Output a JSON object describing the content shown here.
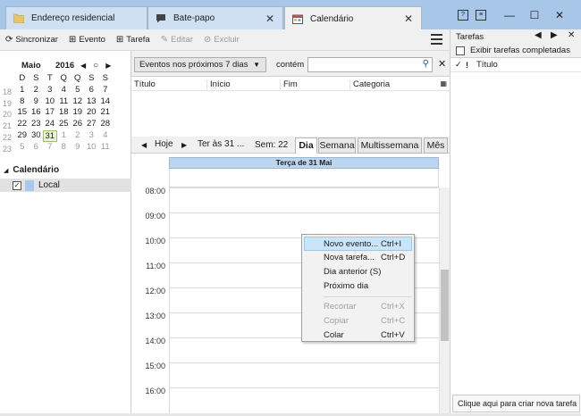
{
  "tabs": [
    {
      "label": "Endereço residencial",
      "icon": "folder-icon"
    },
    {
      "label": "Bate-papo",
      "icon": "chat-icon"
    },
    {
      "label": "Calendário",
      "icon": "calendar-icon"
    }
  ],
  "window": {
    "minimize": "—",
    "maximize": "☐",
    "close": "✕"
  },
  "toolbar": {
    "sync": "Sincronizar",
    "event": "Evento",
    "task": "Tarefa",
    "edit": "Editar",
    "delete": "Excluir"
  },
  "minical": {
    "month": "Maio",
    "year": "2016",
    "weekdays": [
      "D",
      "S",
      "T",
      "Q",
      "Q",
      "S",
      "S"
    ],
    "weeks": [
      {
        "wk": "18",
        "days": [
          "1",
          "2",
          "3",
          "4",
          "5",
          "6",
          "7"
        ]
      },
      {
        "wk": "19",
        "days": [
          "8",
          "9",
          "10",
          "11",
          "12",
          "13",
          "14"
        ]
      },
      {
        "wk": "20",
        "days": [
          "15",
          "16",
          "17",
          "18",
          "19",
          "20",
          "21"
        ]
      },
      {
        "wk": "21",
        "days": [
          "22",
          "23",
          "24",
          "25",
          "26",
          "27",
          "28"
        ]
      },
      {
        "wk": "22",
        "days": [
          "29",
          "30",
          "31",
          "1",
          "2",
          "3",
          "4"
        ]
      },
      {
        "wk": "23",
        "days": [
          "5",
          "6",
          "7",
          "8",
          "9",
          "10",
          "11"
        ]
      }
    ],
    "today": "31"
  },
  "calendars": {
    "title": "Calendário",
    "items": [
      {
        "label": "Local",
        "color": "#a8c8ee",
        "checked": true
      }
    ]
  },
  "filter": {
    "selected": "Eventos nos próximos 7 dias",
    "contains_label": "contém",
    "search_value": ""
  },
  "list_columns": [
    "Título",
    "Início",
    "Fim",
    "Categoria"
  ],
  "daynav": {
    "today": "Hoje",
    "date": "Ter às 31 ...",
    "week": "Sem: 22",
    "views": [
      "Dia",
      "Semana",
      "Multissemana",
      "Mês"
    ],
    "active_view": "Dia"
  },
  "dayview": {
    "header": "Terça de 31 Mai",
    "hours": [
      "08:00",
      "09:00",
      "10:00",
      "11:00",
      "12:00",
      "13:00",
      "14:00",
      "15:00",
      "16:00"
    ]
  },
  "context_menu": {
    "items": [
      {
        "label": "Novo evento...",
        "shortcut": "Ctrl+I",
        "state": "highlighted"
      },
      {
        "label": "Nova tarefa...",
        "shortcut": "Ctrl+D",
        "state": "normal"
      },
      {
        "label": "Dia anterior (S)",
        "shortcut": "",
        "state": "normal"
      },
      {
        "label": "Próximo dia",
        "shortcut": "",
        "state": "normal"
      },
      {
        "label": "Recortar",
        "shortcut": "Ctrl+X",
        "state": "disabled"
      },
      {
        "label": "Copiar",
        "shortcut": "Ctrl+C",
        "state": "disabled"
      },
      {
        "label": "Colar",
        "shortcut": "Ctrl+V",
        "state": "normal"
      }
    ]
  },
  "tasks": {
    "title": "Tarefas",
    "show_completed": "Exibir tarefas completadas",
    "column_title": "Título",
    "new_task_placeholder": "Clique aqui para criar nova tarefa"
  }
}
